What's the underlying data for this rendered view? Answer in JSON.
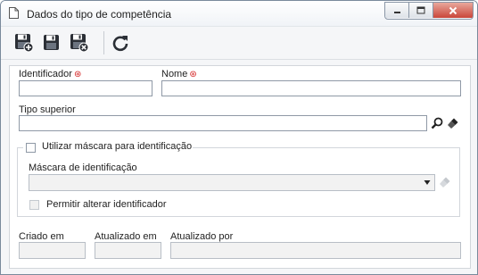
{
  "window": {
    "title": "Dados do tipo de competência",
    "buttons": {
      "minimize": "minimize",
      "maximize": "maximize",
      "close": "close"
    }
  },
  "toolbar": {
    "buttons": [
      {
        "name": "save-and-new-button",
        "icon": "save-plus-icon"
      },
      {
        "name": "save-button",
        "icon": "save-icon"
      },
      {
        "name": "save-and-close-button",
        "icon": "save-close-icon"
      },
      {
        "name": "refresh-button",
        "icon": "refresh-icon"
      }
    ]
  },
  "form": {
    "identifier": {
      "label": "Identificador",
      "value": "",
      "required": true
    },
    "name": {
      "label": "Nome",
      "value": "",
      "required": true
    },
    "parent_type": {
      "label": "Tipo superior",
      "value": ""
    },
    "use_mask": {
      "label": "Utilizar máscara para identificação",
      "checked": false
    },
    "mask": {
      "label": "Máscara de identificação",
      "value": ""
    },
    "allow_change": {
      "label": "Permitir alterar identificador",
      "checked": false
    },
    "created_on": {
      "label": "Criado em",
      "value": ""
    },
    "updated_on": {
      "label": "Atualizado em",
      "value": ""
    },
    "updated_by": {
      "label": "Atualizado por",
      "value": ""
    }
  },
  "colors": {
    "required_marker": "#d32222",
    "close_button": "#c9463a"
  }
}
